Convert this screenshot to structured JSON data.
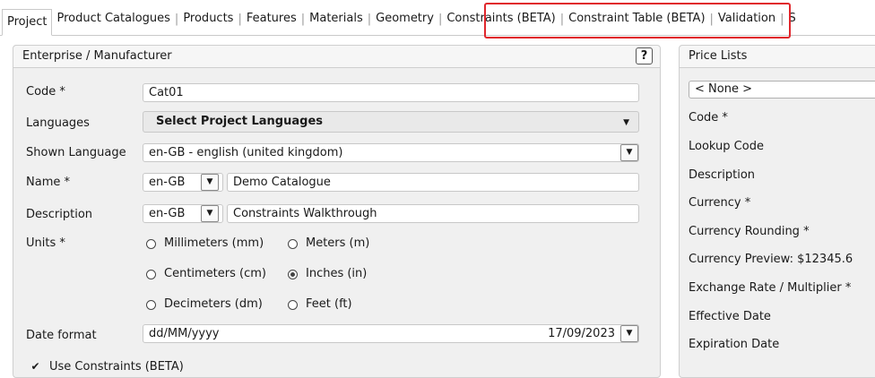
{
  "tabs": [
    "Project",
    "Product Catalogues",
    "Products",
    "Features",
    "Materials",
    "Geometry",
    "Constraints (BETA)",
    "Constraint Table (BETA)",
    "Validation",
    "S"
  ],
  "left_panel": {
    "title": "Enterprise / Manufacturer",
    "help": "?",
    "code_label": "Code *",
    "code_value": "Cat01",
    "languages_label": "Languages",
    "languages_button": "Select Project Languages",
    "shown_language_label": "Shown Language",
    "shown_language_value": "en-GB - english (united kingdom)",
    "name_label": "Name *",
    "name_lang": "en-GB",
    "name_value": "Demo Catalogue",
    "description_label": "Description",
    "description_lang": "en-GB",
    "description_value": "Constraints Walkthrough",
    "units_label": "Units *",
    "units": [
      "Millimeters (mm)",
      "Meters (m)",
      "Centimeters (cm)",
      "Inches (in)",
      "Decimeters (dm)",
      "Feet (ft)"
    ],
    "units_selected": "Inches (in)",
    "date_format_label": "Date format",
    "date_format_value": "dd/MM/yyyy",
    "date_preview": "17/09/2023",
    "use_constraints_label": "Use Constraints (BETA)",
    "use_constraints_checked": true
  },
  "right_panel": {
    "title": "Price Lists",
    "select_value": "< None >",
    "labels": [
      "Code *",
      "Lookup Code",
      "Description",
      "Currency *",
      "Currency Rounding *",
      "Currency Preview: $12345.6",
      "Exchange Rate / Multiplier *",
      "Effective Date",
      "Expiration Date"
    ]
  }
}
